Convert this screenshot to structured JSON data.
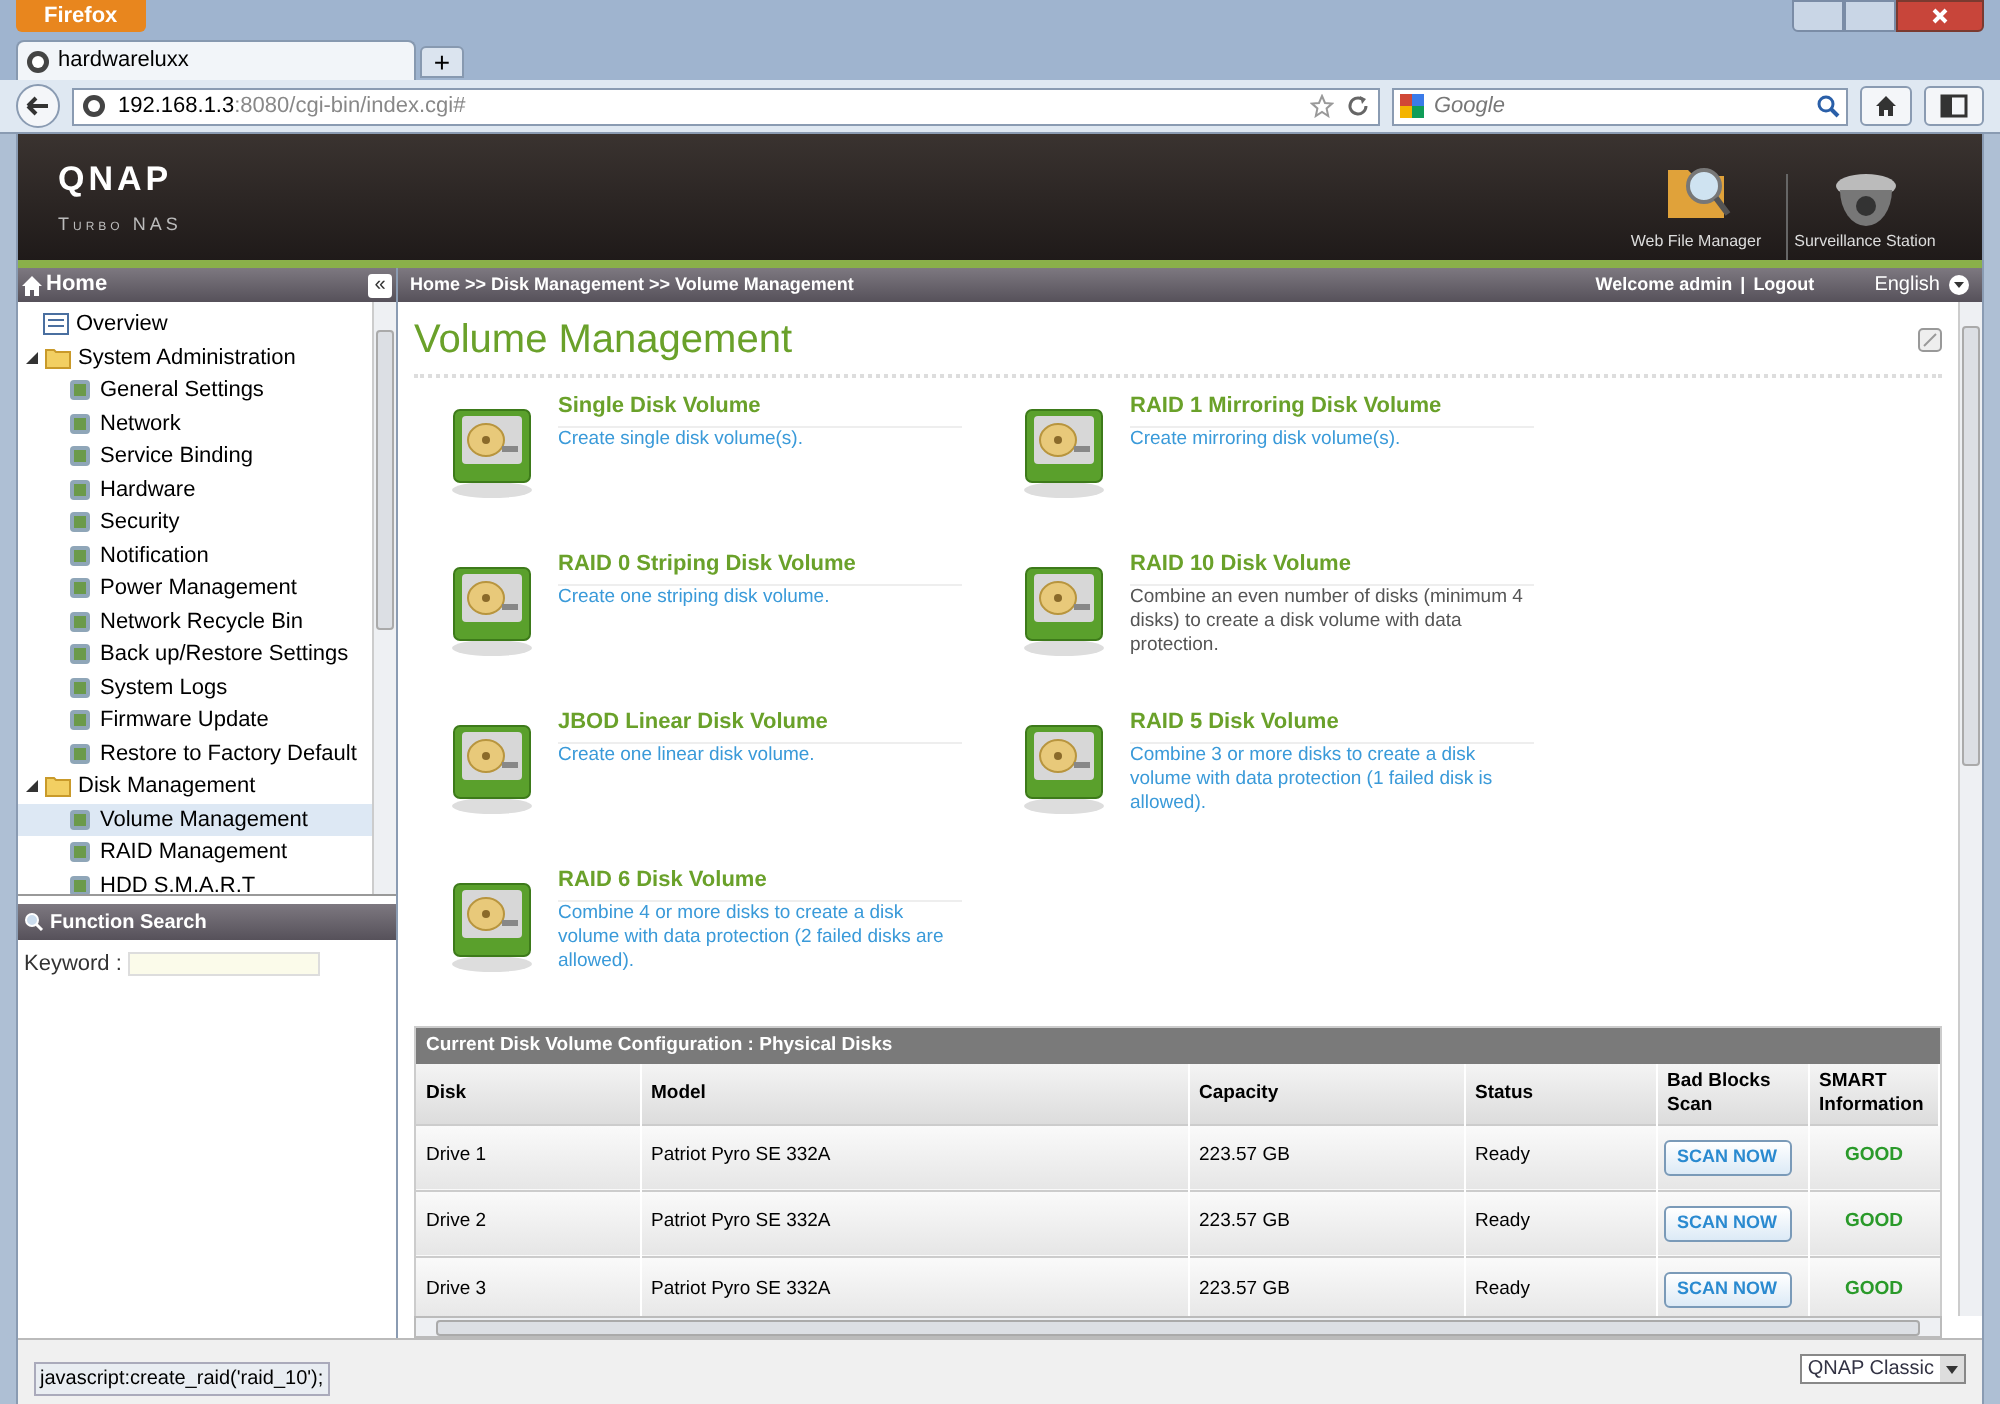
{
  "browser": {
    "menu_button": "Firefox",
    "tab": "hardwareluxx",
    "new_tab": "+",
    "url_host": "192.168.1.3",
    "url_rest": ":8080/cgi-bin/index.cgi#",
    "search_placeholder": "Google"
  },
  "header": {
    "logo": "QNAP",
    "subtitle": "Turbo NAS",
    "apps": [
      {
        "label": "Web File Manager"
      },
      {
        "label": "Surveillance Station"
      }
    ]
  },
  "sidebar": {
    "title": "Home",
    "collapse": "«",
    "items": [
      {
        "label": "Overview",
        "selected": false
      },
      {
        "label": "System Administration",
        "expanded": true,
        "selected": false,
        "children": [
          {
            "label": "General Settings",
            "selected": false
          },
          {
            "label": "Network",
            "selected": false
          },
          {
            "label": "Service Binding",
            "selected": false
          },
          {
            "label": "Hardware",
            "selected": false
          },
          {
            "label": "Security",
            "selected": false
          },
          {
            "label": "Notification",
            "selected": false
          },
          {
            "label": "Power Management",
            "selected": false
          },
          {
            "label": "Network Recycle Bin",
            "selected": false
          },
          {
            "label": "Back up/Restore Settings",
            "selected": false
          },
          {
            "label": "System Logs",
            "selected": false
          },
          {
            "label": "Firmware Update",
            "selected": false
          },
          {
            "label": "Restore to Factory Default",
            "selected": false
          }
        ]
      },
      {
        "label": "Disk Management",
        "expanded": true,
        "selected": false,
        "children": [
          {
            "label": "Volume Management",
            "selected": true
          },
          {
            "label": "RAID Management",
            "selected": false
          },
          {
            "label": "HDD S.M.A.R.T",
            "selected": false
          }
        ]
      }
    ],
    "search_title": "Function Search",
    "keyword_label": "Keyword :"
  },
  "topbar": {
    "breadcrumb": "Home >> Disk Management >> Volume Management",
    "welcome": "Welcome admin",
    "separator": "|",
    "logout": "Logout",
    "language": "English"
  },
  "page_title": "Volume Management",
  "volume_options": [
    {
      "title": "Single Disk Volume",
      "description": "Create single disk volume(s).",
      "hovered": false
    },
    {
      "title": "RAID 1 Mirroring Disk Volume",
      "description": "Create mirroring disk volume(s).",
      "hovered": false
    },
    {
      "title": "RAID 0 Striping Disk Volume",
      "description": "Create one striping disk volume.",
      "hovered": false
    },
    {
      "title": "RAID 10 Disk Volume",
      "description": "Combine an even number of disks (minimum 4 disks) to create a disk volume with data protection.",
      "hovered": true
    },
    {
      "title": "JBOD Linear Disk Volume",
      "description": "Create one linear disk volume.",
      "hovered": false
    },
    {
      "title": "RAID 5 Disk Volume",
      "description": "Combine 3 or more disks to create a disk volume with data protection (1 failed disk is allowed).",
      "hovered": false
    },
    {
      "title": "RAID 6 Disk Volume",
      "description": "Combine 4 or more disks to create a disk volume with data protection (2 failed disks are allowed).",
      "hovered": false
    }
  ],
  "table": {
    "title": "Current Disk Volume Configuration : Physical Disks",
    "columns": [
      "Disk",
      "Model",
      "Capacity",
      "Status",
      "Bad Blocks Scan",
      "SMART Information"
    ],
    "rows": [
      {
        "disk": "Drive 1",
        "model": "Patriot Pyro SE 332A",
        "capacity": "223.57 GB",
        "status": "Ready",
        "scan": "SCAN NOW",
        "smart": "GOOD"
      },
      {
        "disk": "Drive 2",
        "model": "Patriot Pyro SE 332A",
        "capacity": "223.57 GB",
        "status": "Ready",
        "scan": "SCAN NOW",
        "smart": "GOOD"
      },
      {
        "disk": "Drive 3",
        "model": "Patriot Pyro SE 332A",
        "capacity": "223.57 GB",
        "status": "Ready",
        "scan": "SCAN NOW",
        "smart": "GOOD"
      }
    ]
  },
  "status_bar": {
    "link": "javascript:create_raid('raid_10');",
    "theme": "QNAP Classic"
  }
}
